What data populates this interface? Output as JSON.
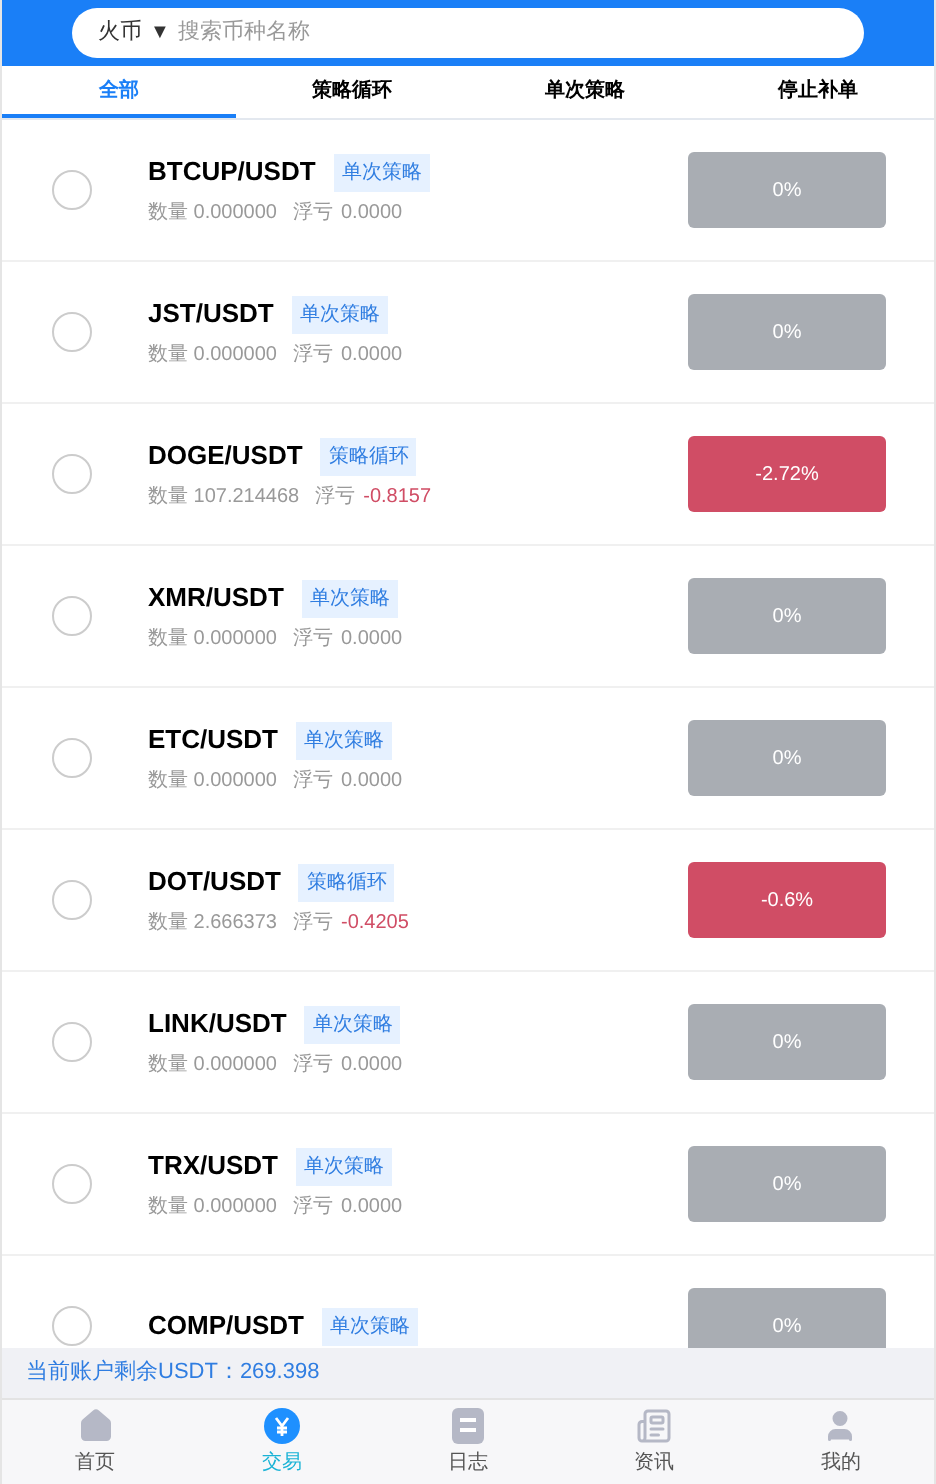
{
  "search": {
    "exchange": "火币",
    "caret": "▼",
    "placeholder": "搜索币种名称"
  },
  "tabs": [
    {
      "label": "全部",
      "selected": true
    },
    {
      "label": "策略循环",
      "selected": false
    },
    {
      "label": "单次策略",
      "selected": false
    },
    {
      "label": "停止补单",
      "selected": false
    }
  ],
  "rows": [
    {
      "pair": "BTCUP/USDT",
      "tag": "单次策略",
      "qty_label": "数量",
      "qty": "0.000000",
      "pnl_label": "浮亏",
      "pnl": "0.0000",
      "loss": false,
      "percent": "0%",
      "checked": false
    },
    {
      "pair": "JST/USDT",
      "tag": "单次策略",
      "qty_label": "数量",
      "qty": "0.000000",
      "pnl_label": "浮亏",
      "pnl": "0.0000",
      "loss": false,
      "percent": "0%",
      "checked": false
    },
    {
      "pair": "DOGE/USDT",
      "tag": "策略循环",
      "qty_label": "数量",
      "qty": "107.214468",
      "pnl_label": "浮亏",
      "pnl": "-0.8157",
      "loss": true,
      "percent": "-2.72%",
      "checked": false
    },
    {
      "pair": "XMR/USDT",
      "tag": "单次策略",
      "qty_label": "数量",
      "qty": "0.000000",
      "pnl_label": "浮亏",
      "pnl": "0.0000",
      "loss": false,
      "percent": "0%",
      "checked": false
    },
    {
      "pair": "ETC/USDT",
      "tag": "单次策略",
      "qty_label": "数量",
      "qty": "0.000000",
      "pnl_label": "浮亏",
      "pnl": "0.0000",
      "loss": false,
      "percent": "0%",
      "checked": false
    },
    {
      "pair": "DOT/USDT",
      "tag": "策略循环",
      "qty_label": "数量",
      "qty": "2.666373",
      "pnl_label": "浮亏",
      "pnl": "-0.4205",
      "loss": true,
      "percent": "-0.6%",
      "checked": false
    },
    {
      "pair": "LINK/USDT",
      "tag": "单次策略",
      "qty_label": "数量",
      "qty": "0.000000",
      "pnl_label": "浮亏",
      "pnl": "0.0000",
      "loss": false,
      "percent": "0%",
      "checked": false
    },
    {
      "pair": "TRX/USDT",
      "tag": "单次策略",
      "qty_label": "数量",
      "qty": "0.000000",
      "pnl_label": "浮亏",
      "pnl": "0.0000",
      "loss": false,
      "percent": "0%",
      "checked": false
    },
    {
      "pair": "COMP/USDT",
      "tag": "单次策略",
      "loss": false,
      "percent": "0%",
      "checked": false
    }
  ],
  "balance": "当前账户剩余USDT：269.398",
  "nav": [
    {
      "kind": "home",
      "label": "首页",
      "selected": false
    },
    {
      "kind": "trade",
      "label": "交易",
      "selected": true
    },
    {
      "kind": "log",
      "label": "日志",
      "selected": false
    },
    {
      "kind": "news",
      "label": "资讯",
      "selected": false
    },
    {
      "kind": "user",
      "label": "我的",
      "selected": false
    }
  ]
}
